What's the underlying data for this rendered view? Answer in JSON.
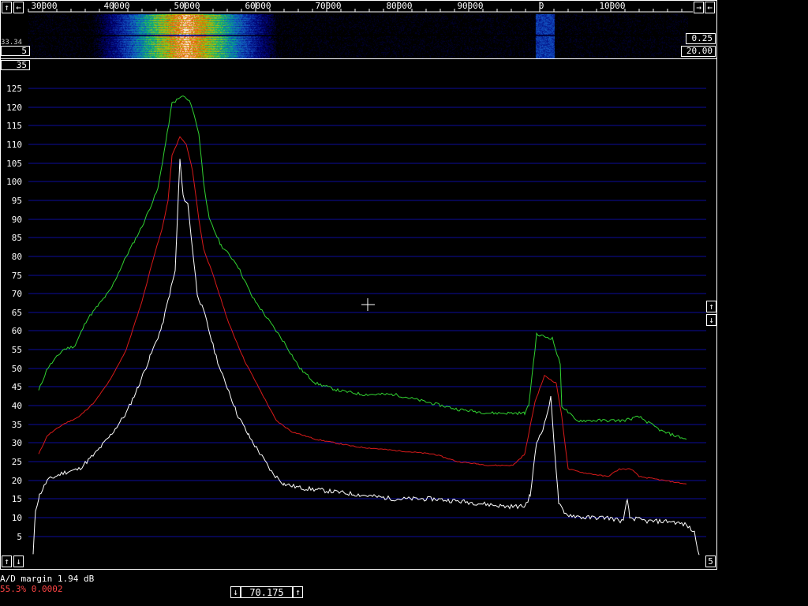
{
  "waterfall": {
    "freq_labels": [
      "30000",
      "40000",
      "50000",
      "60000",
      "70000",
      "80000",
      "90000",
      "0",
      "10000"
    ],
    "left_buttons": {
      "scroll_up": "↑",
      "scroll_left": "←"
    },
    "right_buttons": {
      "scroll_right": "→",
      "scroll_left": "←"
    },
    "partial_label": "33.34",
    "gain_value": "5",
    "right_value_1": "0.25",
    "right_value_2": "20.00",
    "scale_value": "35"
  },
  "spectrum": {
    "y_ticks": [
      "125",
      "120",
      "115",
      "110",
      "105",
      "100",
      "95",
      "90",
      "85",
      "80",
      "75",
      "70",
      "65",
      "60",
      "55",
      "50",
      "45",
      "40",
      "35",
      "30",
      "25",
      "20",
      "15",
      "10",
      "5"
    ],
    "right_buttons": {
      "up": "↑",
      "down": "↓"
    },
    "bottom_left": {
      "up": "↑",
      "down": "↓"
    },
    "bottom_right_value": "5"
  },
  "status": {
    "ad_margin": "A/D margin 1.94 dB",
    "load": "55.3% 0.0002",
    "frequency": "70.175",
    "freq_down": "↓",
    "freq_up": "↑"
  },
  "colors": {
    "grid": "#0b0b9c",
    "green": "#31d231",
    "red": "#d81a1a",
    "white": "#ffffff",
    "load_text": "#ff4545"
  }
}
